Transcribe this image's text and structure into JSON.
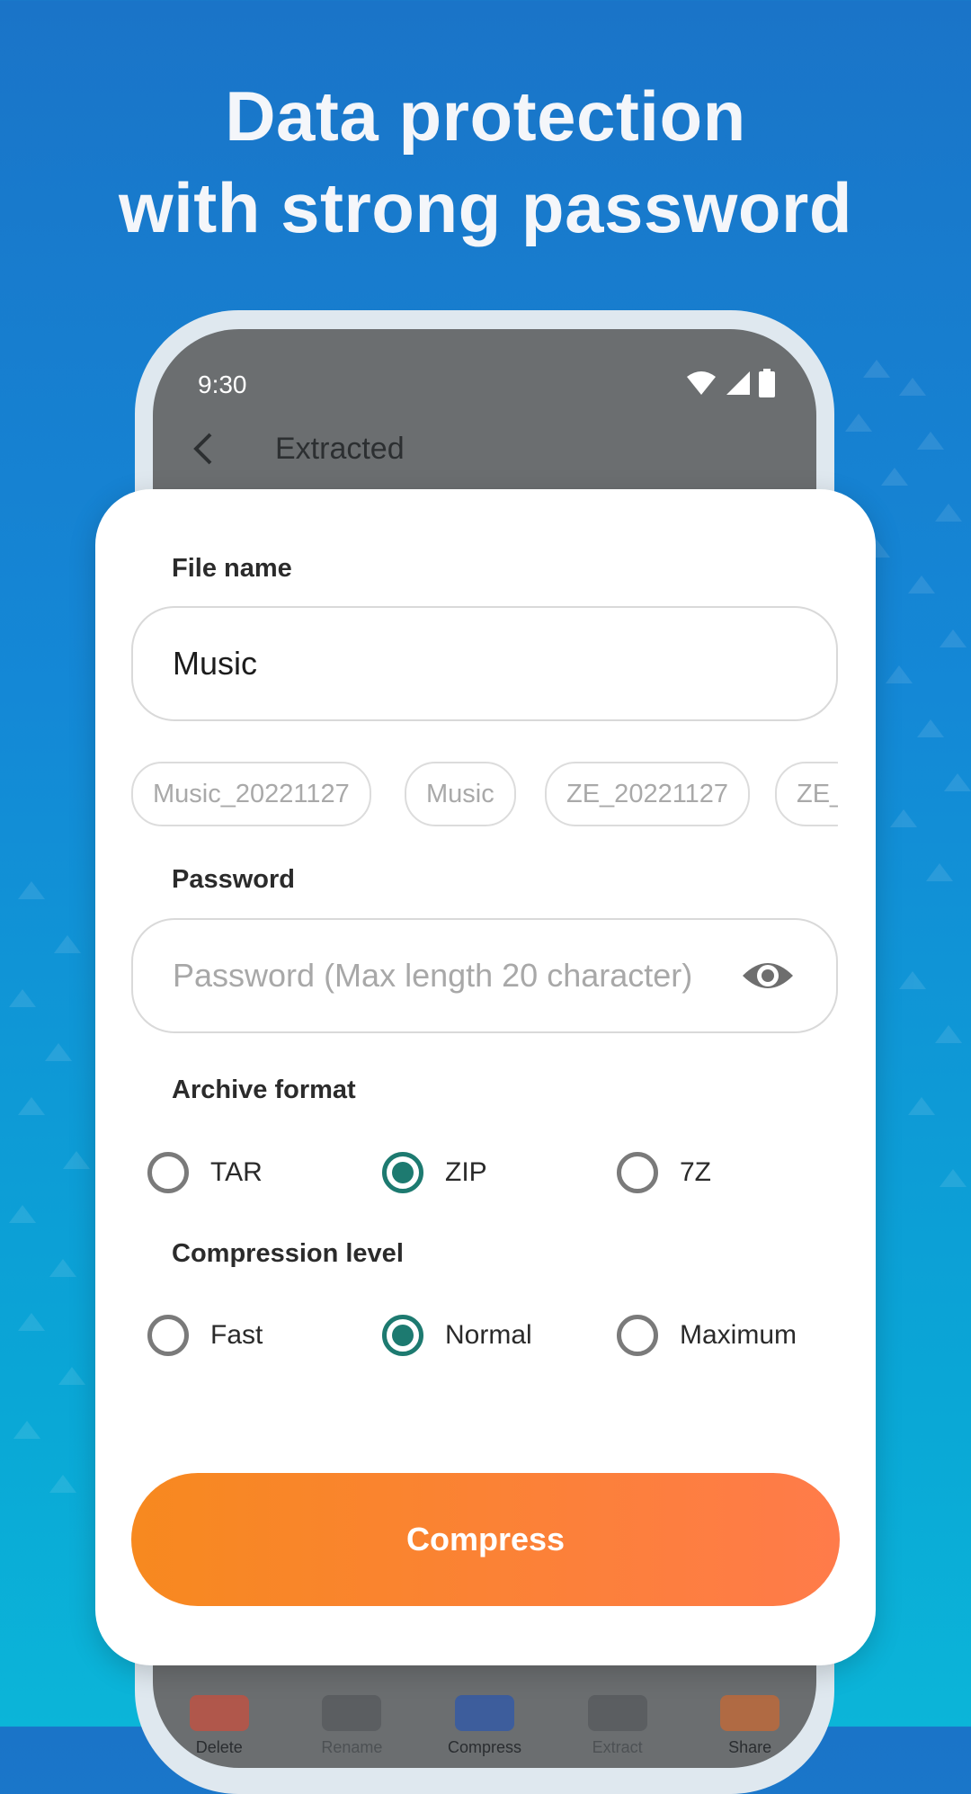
{
  "headline": {
    "line1": "Data protection",
    "line2": "with strong password"
  },
  "status_bar": {
    "time": "9:30",
    "icons": [
      "wifi-icon",
      "signal-icon",
      "battery-icon"
    ]
  },
  "app_bar": {
    "back_icon": "back-arrow-icon",
    "title": "Extracted"
  },
  "dialog": {
    "file_name_label": "File name",
    "file_name_value": "Music",
    "suggestions": [
      "Music_20221127",
      "Music",
      "ZE_20221127",
      "ZE_"
    ],
    "password_label": "Password",
    "password_placeholder": "Password (Max length 20 character)",
    "password_toggle_icon": "eye-icon",
    "archive_format_label": "Archive format",
    "archive_formats": [
      "TAR",
      "ZIP",
      "7Z"
    ],
    "archive_format_selected": "ZIP",
    "compression_label": "Compression level",
    "compression_levels": [
      "Fast",
      "Normal",
      "Maximum"
    ],
    "compression_selected": "Normal",
    "compress_button": "Compress"
  },
  "bottom_nav": {
    "items": [
      {
        "label": "Delete",
        "icon": "trash-icon",
        "color": "#b0574b"
      },
      {
        "label": "Rename",
        "icon": "rename-icon",
        "color": "#5b5e61"
      },
      {
        "label": "Compress",
        "icon": "compress-icon",
        "color": "#3d5d9c"
      },
      {
        "label": "Extract",
        "icon": "extract-icon",
        "color": "#5b5e61"
      },
      {
        "label": "Share",
        "icon": "share-icon",
        "color": "#b06a43"
      }
    ]
  },
  "colors": {
    "accent_radio": "#1d7a70",
    "button_gradient_start": "#f7891f",
    "button_gradient_end": "#ff7b4a",
    "background_top": "#1a74c8",
    "background_bottom": "#0bb5d8"
  }
}
